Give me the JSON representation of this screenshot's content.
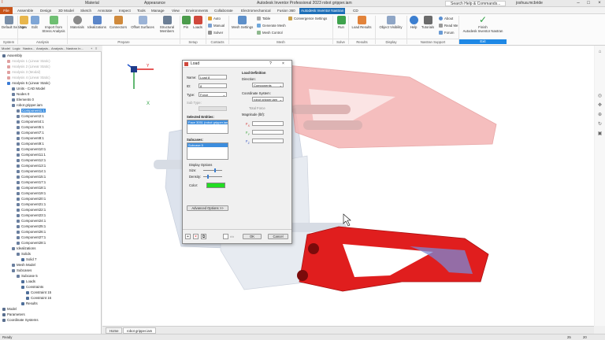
{
  "window": {
    "quick_access_1": "Material",
    "quick_access_2": "Appearance",
    "title": "Autodesk Inventor Professional 2023   robot gripper.iam",
    "search_placeholder": "Search Help & Commands...",
    "user": "joshua.mcbride"
  },
  "tabs": [
    "File",
    "Assemble",
    "Design",
    "3D Model",
    "Sketch",
    "Annotate",
    "Inspect",
    "Tools",
    "Manage",
    "View",
    "Environments",
    "Collaborate",
    "Electromechanical",
    "Fusion 360",
    "Autodesk Inventor Nastran",
    "CD"
  ],
  "ribbon": {
    "default_settings": "Default Settings",
    "new": "New",
    "edit": "Edit",
    "import_from_stress": "Import from Stress Analysis",
    "materials": "Materials",
    "idealizations": "Idealizations",
    "connectors": "Connectors",
    "offset_surfaces": "Offset Surfaces",
    "structural_members": "Structural Members",
    "pin": "Pin",
    "loads": "Loads",
    "auto": "Auto",
    "manual": "Manual",
    "solver": "Solver",
    "mesh_settings": "Mesh Settings",
    "table": "Table",
    "generate_mesh": "Generate Mesh",
    "mesh_control": "Mesh Control",
    "convergence_settings": "Convergence Settings",
    "run": "Run",
    "load_results": "Load Results",
    "object_visibility": "Object Visibility",
    "help": "Help",
    "tutorials": "Tutorials",
    "about": "About",
    "read_me": "Read Me",
    "forum": "Forum",
    "finish": "Finish",
    "finish_sub": "Autodesk Inventor Nastran",
    "groups": {
      "system": "System",
      "analysis": "Analysis",
      "prepare": "Prepare",
      "setup": "Setup",
      "contacts": "Contacts",
      "mesh": "Mesh",
      "solve": "Solve",
      "results": "Results",
      "display": "Display",
      "nastran_support": "Nastran Support",
      "exit": "Exit"
    }
  },
  "browser": {
    "tabs": [
      "Model",
      "Logic",
      "Nastra...",
      "Analysis...",
      "Analysis...",
      "Nastran In..."
    ],
    "tree": [
      {
        "label": "Assembly",
        "indent": 0,
        "state": "normal"
      },
      {
        "label": "Analysis 1 (Linear Static)",
        "indent": 1,
        "state": "dim"
      },
      {
        "label": "Analysis 2 (Linear Static)",
        "indent": 1,
        "state": "dim"
      },
      {
        "label": "Analysis 3 (Modal)",
        "indent": 1,
        "state": "dim"
      },
      {
        "label": "Analysis 4 (Linear Static)",
        "indent": 1,
        "state": "dim"
      },
      {
        "label": "Analysis 5 (Linear Static)",
        "indent": 1,
        "state": "normal"
      },
      {
        "label": "Units - CAD Model",
        "indent": 2,
        "state": "normal"
      },
      {
        "label": "Nodes 0",
        "indent": 2,
        "state": "normal"
      },
      {
        "label": "Elements 0",
        "indent": 2,
        "state": "normal"
      },
      {
        "label": "robot gripper.iam",
        "indent": 2,
        "state": "normal"
      },
      {
        "label": "Component1:1",
        "indent": 3,
        "state": "selected"
      },
      {
        "label": "Component2:1",
        "indent": 3,
        "state": "normal"
      },
      {
        "label": "Component4:1",
        "indent": 3,
        "state": "normal"
      },
      {
        "label": "Component5:1",
        "indent": 3,
        "state": "normal"
      },
      {
        "label": "Component7:1",
        "indent": 3,
        "state": "normal"
      },
      {
        "label": "Component8:1",
        "indent": 3,
        "state": "normal"
      },
      {
        "label": "Component9:1",
        "indent": 3,
        "state": "normal"
      },
      {
        "label": "Component10:1",
        "indent": 3,
        "state": "normal"
      },
      {
        "label": "Component11:1",
        "indent": 3,
        "state": "normal"
      },
      {
        "label": "Component12:1",
        "indent": 3,
        "state": "normal"
      },
      {
        "label": "Component13:1",
        "indent": 3,
        "state": "normal"
      },
      {
        "label": "Component14:1",
        "indent": 3,
        "state": "normal"
      },
      {
        "label": "Component15:1",
        "indent": 3,
        "state": "normal"
      },
      {
        "label": "Component17:1",
        "indent": 3,
        "state": "normal"
      },
      {
        "label": "Component18:1",
        "indent": 3,
        "state": "normal"
      },
      {
        "label": "Component19:1",
        "indent": 3,
        "state": "normal"
      },
      {
        "label": "Component20:1",
        "indent": 3,
        "state": "normal"
      },
      {
        "label": "Component21:1",
        "indent": 3,
        "state": "normal"
      },
      {
        "label": "Component22:1",
        "indent": 3,
        "state": "normal"
      },
      {
        "label": "Component23:1",
        "indent": 3,
        "state": "normal"
      },
      {
        "label": "Component24:1",
        "indent": 3,
        "state": "normal"
      },
      {
        "label": "Component25:1",
        "indent": 3,
        "state": "normal"
      },
      {
        "label": "Component26:1",
        "indent": 3,
        "state": "normal"
      },
      {
        "label": "Component27:1",
        "indent": 3,
        "state": "normal"
      },
      {
        "label": "Component28:1",
        "indent": 3,
        "state": "normal"
      },
      {
        "label": "Idealizations",
        "indent": 2,
        "state": "normal"
      },
      {
        "label": "Solids",
        "indent": 3,
        "state": "normal"
      },
      {
        "label": "Solid 7",
        "indent": 4,
        "state": "normal"
      },
      {
        "label": "Mesh Model",
        "indent": 2,
        "state": "normal"
      },
      {
        "label": "Subcases",
        "indent": 2,
        "state": "normal"
      },
      {
        "label": "Subcase 5",
        "indent": 3,
        "state": "normal"
      },
      {
        "label": "Loads",
        "indent": 4,
        "state": "normal"
      },
      {
        "label": "Constraints",
        "indent": 4,
        "state": "normal"
      },
      {
        "label": "Constraint 15",
        "indent": 5,
        "state": "normal"
      },
      {
        "label": "Constraint 16",
        "indent": 5,
        "state": "normal"
      },
      {
        "label": "Results",
        "indent": 4,
        "state": "normal"
      },
      {
        "label": "Model",
        "indent": 0,
        "state": "normal"
      },
      {
        "label": "Parameters",
        "indent": 0,
        "state": "normal"
      },
      {
        "label": "Coordinate Systems",
        "indent": 0,
        "state": "normal"
      }
    ]
  },
  "dialog": {
    "title": "Load",
    "help": "?",
    "name_label": "Name:",
    "name_value": "Load 8",
    "id_label": "ID:",
    "id_value": "8",
    "type_label": "Type:",
    "type_value": "Force",
    "subtype_label": "Sub Type:",
    "selected_entities_label": "Selected Entities:",
    "selected_entity": "Face 3051 (robot gripper.iam:1)",
    "subcases_label": "Subcases:",
    "subcase_item": "Subcase 5",
    "display_options_label": "Display Options",
    "size_label": "Size:",
    "density_label": "Density:",
    "color_label": "Color:",
    "advanced_options": "Advanced Options >>",
    "load_definition_label": "Load Definition",
    "direction_label": "Direction:",
    "direction_value": "Components",
    "coord_system_label": "Coordinate System:",
    "coord_system_value": "robot gripper.iam",
    "total_force_label": "Total Force",
    "magnitude_label": "Magnitude (lbf):",
    "fx": "F",
    "fy": "F",
    "fz": "F",
    "fx_sub": "X",
    "fy_sub": "Y",
    "fz_sub": "Z",
    "ok": "OK",
    "cancel": "Cancel",
    "color_swatch": "#22dd22"
  },
  "doc_tabs": {
    "home": "Home",
    "file": "robot gripper.iam"
  },
  "status": {
    "left": "Ready",
    "n1": "25",
    "n2": "20"
  },
  "colors": {
    "accent": "#1e6fb8",
    "file_tab": "#c8541a",
    "part_red": "#e01e1e",
    "ghost_red": "#f4b3b3",
    "ghost_blue": "#b8c6dc"
  }
}
